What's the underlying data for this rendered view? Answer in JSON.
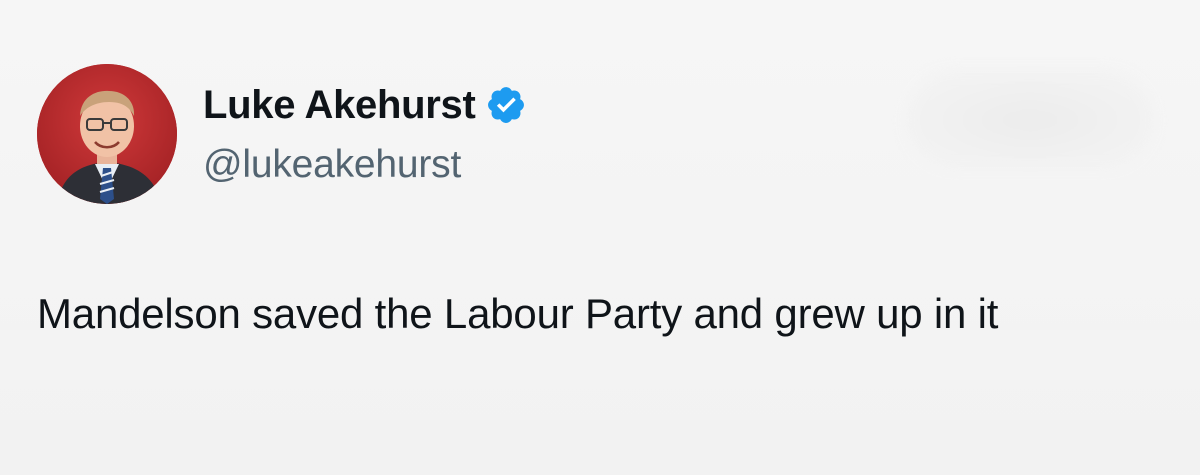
{
  "author": {
    "display_name": "Luke Akehurst",
    "handle": "@lukeakehurst",
    "verified": true,
    "avatar_icon": "profile-photo"
  },
  "tweet": {
    "text": "Mandelson saved the Labour Party and grew up in it"
  },
  "colors": {
    "verified_blue": "#1d9bf0",
    "handle_gray": "#536471",
    "text_black": "#0f1419",
    "avatar_background": "#b8282a"
  }
}
